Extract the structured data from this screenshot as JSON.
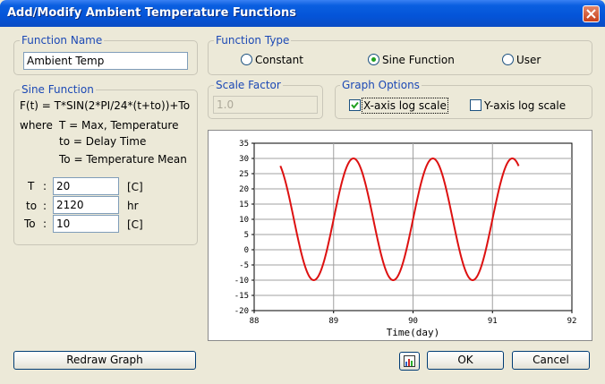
{
  "window": {
    "title": "Add/Modify Ambient Temperature Functions"
  },
  "function_name": {
    "legend": "Function Name",
    "value": "Ambient Temp"
  },
  "function_type": {
    "legend": "Function Type",
    "options": [
      {
        "label": "Constant",
        "selected": false
      },
      {
        "label": "Sine Function",
        "selected": true
      },
      {
        "label": "User",
        "selected": false
      }
    ]
  },
  "sine_function": {
    "legend": "Sine Function",
    "formula": "F(t)  =  T*SIN(2*PI/24*(t+to))+To",
    "where_label": "where",
    "def_T": "T  =  Max, Temperature",
    "def_to": "to  =  Delay Time",
    "def_To": "To = Temperature Mean",
    "params": [
      {
        "name": "T",
        "colon": ":",
        "value": "20",
        "unit": "[C]"
      },
      {
        "name": "to",
        "colon": ":",
        "value": "2120",
        "unit": "hr"
      },
      {
        "name": "To",
        "colon": ":",
        "value": "10",
        "unit": "[C]"
      }
    ]
  },
  "scale_factor": {
    "legend": "Scale Factor",
    "value": "1.0"
  },
  "graph_options": {
    "legend": "Graph Options",
    "x_log": {
      "label": "X-axis log scale",
      "checked": true
    },
    "y_log": {
      "label": "Y-axis log scale",
      "checked": false
    }
  },
  "buttons": {
    "redraw": "Redraw Graph",
    "ok": "OK",
    "cancel": "Cancel",
    "graph_icon": "graph-icon"
  },
  "colors": {
    "series": "#dd1111",
    "title_bar": "#0454d8",
    "group_label": "#1c49b5"
  },
  "chart_data": {
    "type": "line",
    "xlabel": "Time(day)",
    "ylabel": "",
    "xlim": [
      88,
      92
    ],
    "ylim": [
      -20,
      35
    ],
    "x_ticks": [
      88,
      89,
      90,
      91,
      92
    ],
    "y_ticks": [
      35,
      30,
      25,
      20,
      15,
      10,
      5,
      0,
      -5,
      -10,
      -15,
      -20
    ],
    "grid": true,
    "series": [
      {
        "values_description": "",
        "x": [
          88.33,
          88.5,
          88.67,
          88.83,
          89.0,
          89.17,
          89.33,
          89.5,
          89.67,
          89.83,
          90.0,
          90.17,
          90.33,
          90.5,
          90.67,
          90.83,
          91.0,
          91.17,
          91.33
        ],
        "y": [
          27.3,
          10.0,
          -7.3,
          -7.3,
          10.0,
          27.3,
          27.3,
          10.0,
          -7.3,
          -7.3,
          10.0,
          27.3,
          27.3,
          10.0,
          -7.3,
          -7.3,
          10.0,
          27.3,
          27.3
        ]
      }
    ]
  }
}
